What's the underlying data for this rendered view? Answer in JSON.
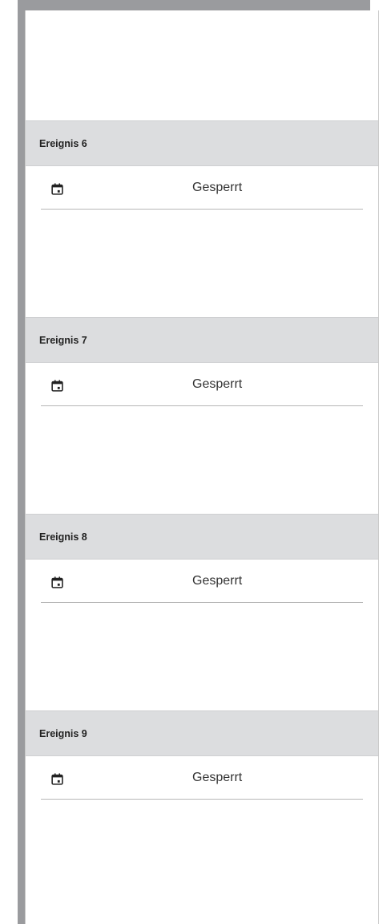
{
  "events": [
    {
      "header": "Ereignis 6",
      "status": "Gesperrt",
      "icon": "calendar-icon"
    },
    {
      "header": "Ereignis 7",
      "status": "Gesperrt",
      "icon": "calendar-icon"
    },
    {
      "header": "Ereignis 8",
      "status": "Gesperrt",
      "icon": "calendar-icon"
    },
    {
      "header": "Ereignis 9",
      "status": "Gesperrt",
      "icon": "calendar-icon"
    }
  ],
  "colors": {
    "frame": "#9a9b9e",
    "header_bg": "#dcdddf",
    "text": "#333333"
  }
}
